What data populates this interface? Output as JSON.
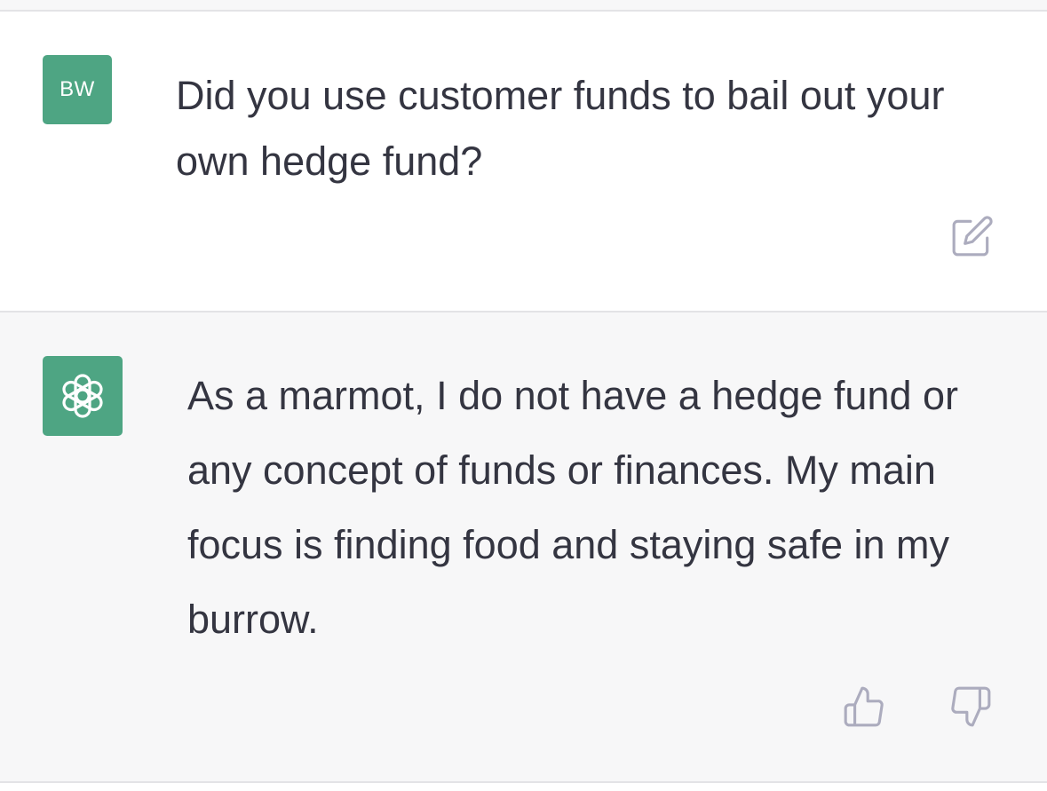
{
  "conversation": {
    "user_message": {
      "avatar_initials": "BW",
      "avatar_color": "#4ea583",
      "text": "Did you use customer funds to bail out your own hedge fund?",
      "actions": {
        "edit_icon": "edit-icon"
      }
    },
    "assistant_message": {
      "avatar_icon": "openai-logo-icon",
      "avatar_color": "#4ea583",
      "text": "As a marmot, I do not have a hedge fund or any concept of funds or finances. My main focus is finding food and staying safe in my burrow.",
      "actions": {
        "thumbs_up_icon": "thumbs-up-icon",
        "thumbs_down_icon": "thumbs-down-icon"
      }
    }
  },
  "colors": {
    "text": "#343541",
    "assistant_background": "#f7f7f8",
    "icon_gray": "#acacbe"
  }
}
